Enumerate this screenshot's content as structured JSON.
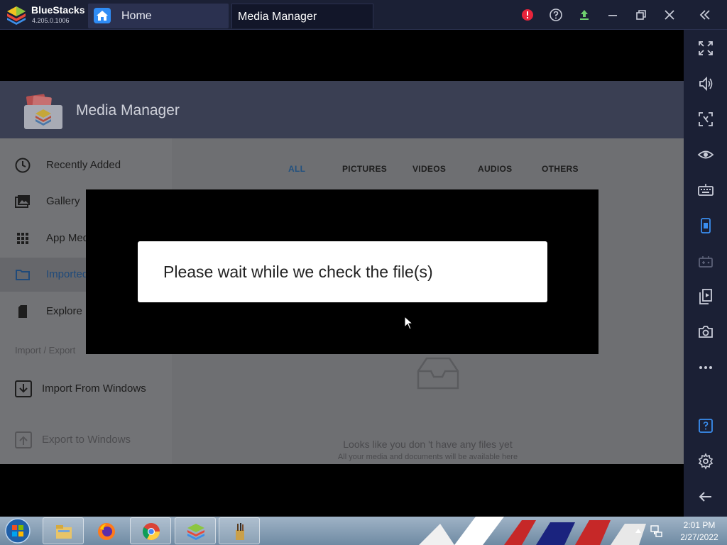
{
  "window": {
    "app_name": "BlueStacks",
    "version": "4.205.0.1006",
    "tabs": [
      {
        "label": "Home"
      },
      {
        "label": "Media Manager"
      }
    ]
  },
  "media_manager": {
    "title": "Media Manager",
    "nav": [
      {
        "label": "Recently Added",
        "icon": "clock-icon"
      },
      {
        "label": "Gallery",
        "icon": "gallery-icon"
      },
      {
        "label": "App Media",
        "icon": "grid-icon"
      },
      {
        "label": "Imported",
        "icon": "folder-icon"
      },
      {
        "label": "Explore",
        "icon": "sdcard-icon"
      }
    ],
    "section_label": "Import / Export",
    "import_label": "Import From Windows",
    "export_label": "Export to Windows",
    "filter_tabs": [
      "ALL",
      "PICTURES",
      "VIDEOS",
      "AUDIOS",
      "OTHERS"
    ],
    "active_filter": "ALL",
    "empty_title": "Looks like you don 't have any files yet",
    "empty_subtitle": "All your media and documents will be available here"
  },
  "dialog": {
    "message": "Please wait while we check the file(s)"
  },
  "taskbar": {
    "time": "2:01 PM",
    "date": "2/27/2022"
  },
  "colors": {
    "titlebar": "#1b2035",
    "accent": "#2f8cf5",
    "alert": "#e8243b"
  }
}
